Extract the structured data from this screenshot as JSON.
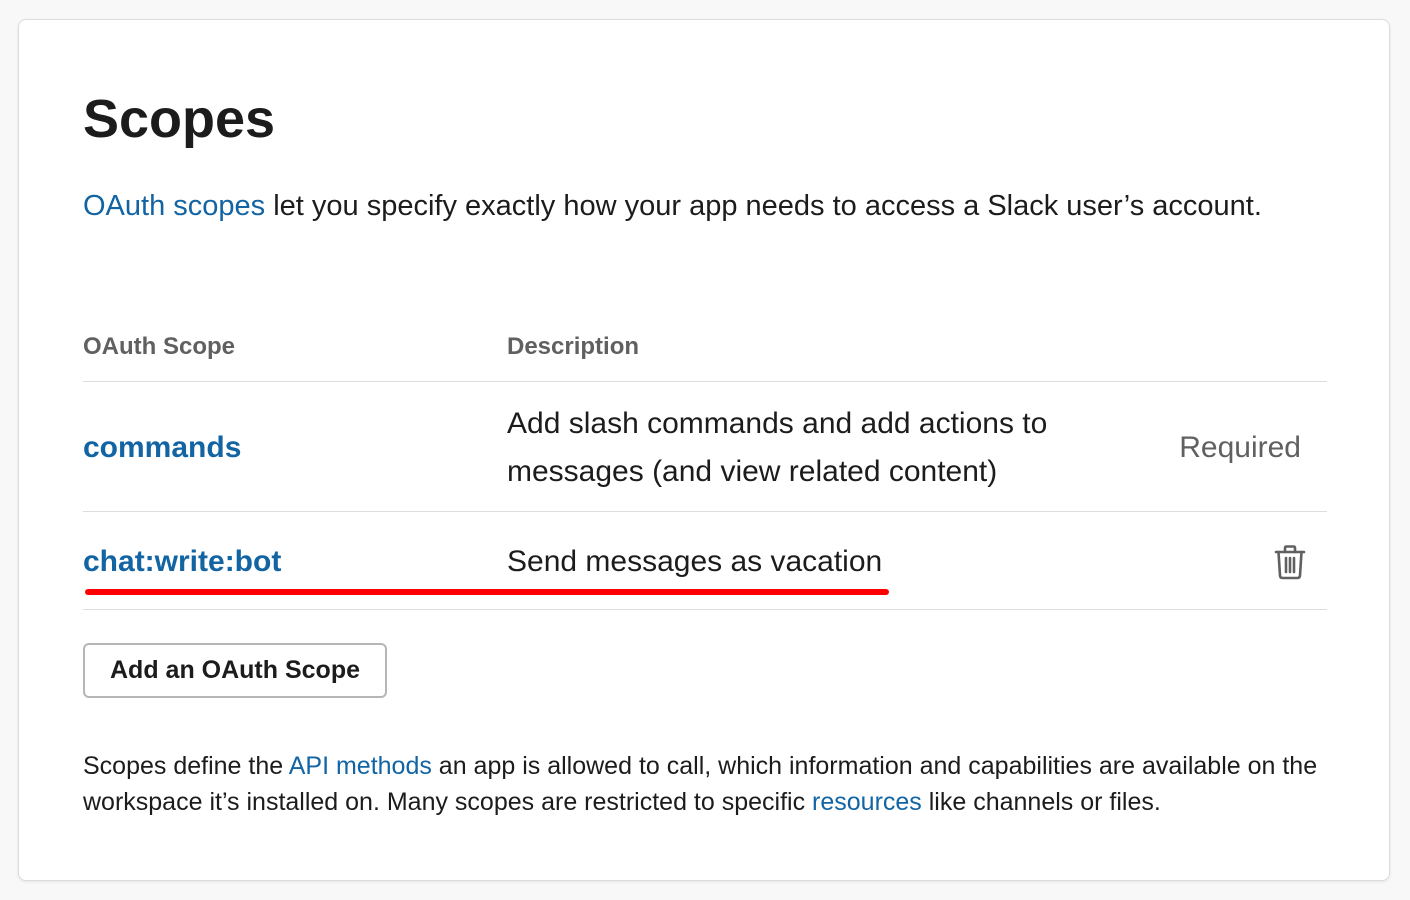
{
  "section": {
    "title": "Scopes",
    "intro": {
      "link_text": "OAuth scopes",
      "text": " let you specify exactly how your app needs to access a Slack user’s account."
    }
  },
  "table": {
    "headers": [
      "OAuth Scope",
      "Description"
    ],
    "rows": [
      {
        "scope": "commands",
        "description": "Add slash commands and add actions to messages (and view related content)",
        "status": "Required"
      },
      {
        "scope": "chat:write:bot",
        "description": "Send messages as vacation",
        "action_icon": "trash-icon"
      }
    ]
  },
  "add_button": {
    "label": "Add an OAuth Scope"
  },
  "footnote": {
    "part1": "Scopes define the ",
    "link1": "API methods",
    "part2": " an app is allowed to call, which information and capabilities are available on the workspace it’s installed on. Many scopes are restricted to specific ",
    "link2": "resources",
    "part3": " like channels or files."
  },
  "colors": {
    "link": "#1264a3",
    "annotation": "#ff0000",
    "muted": "#616061"
  }
}
